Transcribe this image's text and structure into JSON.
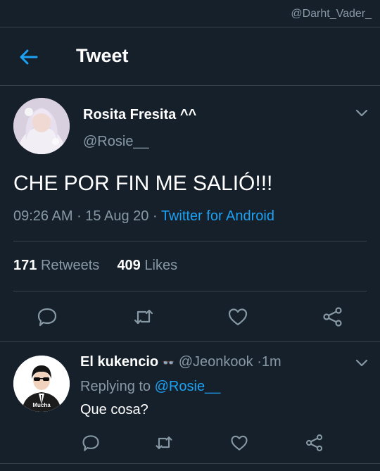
{
  "watermark": "@Darht_Vader_",
  "header": {
    "title": "Tweet",
    "back_icon": "arrow-left-icon"
  },
  "tweet": {
    "author_name": "Rosita Fresita ^^",
    "author_handle": "@Rosie__",
    "text": "CHE POR FIN ME SALIÓ!!!",
    "time": "09:26 AM",
    "date": "15 Aug 20",
    "source": "Twitter for Android",
    "retweets_count": "171",
    "retweets_label": "Retweets",
    "likes_count": "409",
    "likes_label": "Likes",
    "actions": [
      "comment-icon",
      "retweet-icon",
      "like-icon",
      "share-icon"
    ]
  },
  "reply": {
    "author_name": "El kukencio",
    "author_glyph": "👓",
    "author_handle": "@Jeonkook",
    "age": "1m",
    "replying_label": "Replying to",
    "replying_handle": "@Rosie__",
    "text": "Que cosa?",
    "avatar_caption": "Mucha",
    "actions": [
      "comment-icon",
      "retweet-icon",
      "like-icon",
      "share-icon"
    ]
  },
  "colors": {
    "background": "#15202b",
    "accent": "#1da1f2",
    "muted": "#8899a6",
    "divider": "#38444d"
  }
}
